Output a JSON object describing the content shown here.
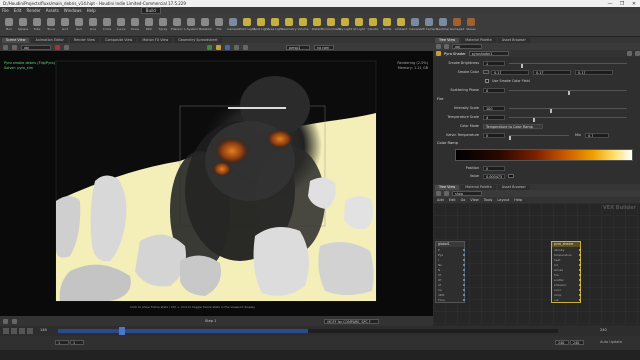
{
  "window": {
    "title": "D:/HoudiniProjects/fluxs/main_debris_v14.hipt - Houdini Indie Limited-Commercial 17.5.229",
    "controls": [
      "—",
      "❐",
      "✕"
    ]
  },
  "menu": {
    "items": [
      "File",
      "Edit",
      "Render",
      "Assets",
      "Windows",
      "Help"
    ],
    "desktop": "Build"
  },
  "shelf": {
    "tools": [
      {
        "label": "Box",
        "color": "#8a8a8a"
      },
      {
        "label": "Sphere",
        "color": "#8a8a8a"
      },
      {
        "label": "Tube",
        "color": "#8a8a8a"
      },
      {
        "label": "Torus",
        "color": "#8a8a8a"
      },
      {
        "label": "Grid",
        "color": "#8a8a8a"
      },
      {
        "label": "Null",
        "color": "#8a8a8a"
      },
      {
        "label": "Line",
        "color": "#8a8a8a"
      },
      {
        "label": "Circle",
        "color": "#8a8a8a"
      },
      {
        "label": "Curve",
        "color": "#8a8a8a"
      },
      {
        "label": "Draw",
        "color": "#8a8a8a"
      },
      {
        "label": "Path",
        "color": "#8a8a8a"
      },
      {
        "label": "Spray",
        "color": "#8a8a8a"
      },
      {
        "label": "Platonic",
        "color": "#8a8a8a"
      },
      {
        "label": "L-System",
        "color": "#8a8a8a"
      },
      {
        "label": "Metaball",
        "color": "#8a8a8a"
      },
      {
        "label": "File",
        "color": "#8a8a8a"
      },
      {
        "label": "Camera",
        "color": "#7a8aa0"
      },
      {
        "label": "Point Light",
        "color": "#c8b040"
      },
      {
        "label": "Spot Light",
        "color": "#c8b040"
      },
      {
        "label": "Area Light",
        "color": "#c8b040"
      },
      {
        "label": "Geometry",
        "color": "#c8b040"
      },
      {
        "label": "Volume",
        "color": "#c8b040"
      },
      {
        "label": "Distant",
        "color": "#c8b040"
      },
      {
        "label": "Environment",
        "color": "#c8b040"
      },
      {
        "label": "Sky Light",
        "color": "#c8b040"
      },
      {
        "label": "GI Light",
        "color": "#c8b040"
      },
      {
        "label": "Caustic",
        "color": "#c8b040"
      },
      {
        "label": "Portal",
        "color": "#c8b040"
      },
      {
        "label": "Ambient",
        "color": "#c8b040"
      },
      {
        "label": "Camera",
        "color": "#7a8aa0"
      },
      {
        "label": "VR Camera",
        "color": "#7a8aa0"
      },
      {
        "label": "Switcher",
        "color": "#7a8aa0"
      },
      {
        "label": "Gamepad",
        "color": "#a06030"
      },
      {
        "label": "Stereo",
        "color": "#a06030"
      }
    ]
  },
  "viewport": {
    "tabs": [
      "Scene View",
      "Animation Editor",
      "Render View",
      "Composite View",
      "Motion FX View",
      "Geometry Spreadsheet"
    ],
    "active_tab": "Scene View",
    "path": "obj",
    "camera_label": "persp1",
    "display_label": "no cam",
    "overlay_text": "Pyro smoke debris (Flip/Pyro)",
    "overlay_sub": "Solver: pyro_sim",
    "status_right": "Rendering (2.5%)",
    "status_right_2": "Memory: 1.21 GB",
    "bottom_message": "Click to show frame stats / Ctrl + click to toggle frame stats in the viewport display",
    "frame_label": "Step 1",
    "cache_label": "MOFF for COMPARE, SPC F"
  },
  "params": {
    "tabs": [
      "Tree View",
      "Material Palette",
      "Asset Browser"
    ],
    "path": "obj",
    "node_type": "Pyro Shader",
    "node_name": "pyroshader1",
    "rows": [
      {
        "label": "Smoke Brightness",
        "value": "1",
        "knob": 0.1
      },
      {
        "label": "Smoke Color",
        "values": [
          "0.17",
          "0.17",
          "0.17"
        ]
      },
      {
        "label": "Use Smoke Color Field",
        "checkbox": true
      },
      {
        "label": "Scattering Phase",
        "value": "0",
        "knob": 0.5
      },
      {
        "label": "Fire",
        "section": true
      },
      {
        "label": "Intensity Scale",
        "value": "100",
        "knob": 0.35
      },
      {
        "label": "Temperature Scale",
        "value": "4",
        "knob": 0.2
      },
      {
        "label": "Color Mode",
        "dropdown": "Temperature to Color Ramp"
      },
      {
        "label": "Kelvin Temperature",
        "value": "0",
        "knob": 0.0
      },
      {
        "label": "Color Ramp",
        "section": true
      },
      {
        "label": "Position",
        "value": "0"
      },
      {
        "label": "Value",
        "value": "0.000473"
      }
    ],
    "mix_label": "Mix",
    "mix_value": "0.7"
  },
  "network": {
    "tabs": [
      "Tree View",
      "Material Palette",
      "Asset Browser"
    ],
    "path": "shop",
    "menu": [
      "Add",
      "Edit",
      "Go",
      "View",
      "Tools",
      "Layout",
      "Help"
    ],
    "title": "VEX Builder",
    "nodes": [
      {
        "name": "global1",
        "ports": [
          "P",
          "Eye",
          "I",
          "Ns",
          "N",
          "Cf",
          "Of",
          "Af",
          "Ce",
          "dPdt",
          "Time"
        ]
      },
      {
        "name": "pyro_shader",
        "ports": [
          "density",
          "temperature",
          "heat",
          "Cd",
          "smoke",
          "fire",
          "scatter",
          "emission",
          "color",
          "ramp",
          "out"
        ]
      }
    ]
  },
  "timeline": {
    "start": "1",
    "end": "240",
    "current": "148",
    "range_start": "1",
    "range_end": "240",
    "range_start_2": "1",
    "range_end_2": "240",
    "status_text": "Auto Update"
  }
}
